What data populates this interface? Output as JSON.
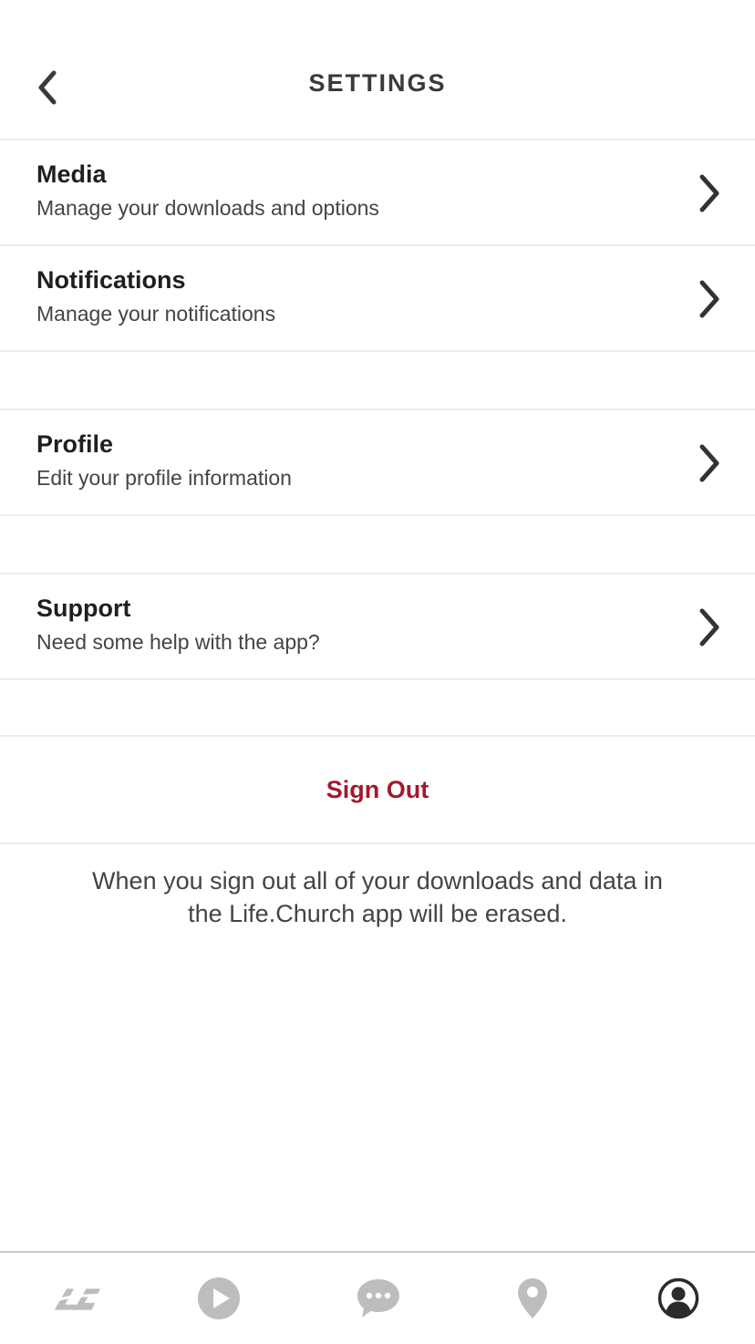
{
  "header": {
    "title": "SETTINGS"
  },
  "sections": [
    {
      "id": "media",
      "title": "Media",
      "subtitle": "Manage your downloads and options"
    },
    {
      "id": "notifications",
      "title": "Notifications",
      "subtitle": "Manage your notifications"
    },
    {
      "id": "profile",
      "title": "Profile",
      "subtitle": "Edit your profile information"
    },
    {
      "id": "support",
      "title": "Support",
      "subtitle": "Need some help with the app?"
    }
  ],
  "sign_out": {
    "label": "Sign Out",
    "color": "#a3192c",
    "warning": "When you sign out all of your downloads and data in the Life.Church app will be erased."
  },
  "tabbar": {
    "tabs": [
      {
        "icon": "lifechurch-logo-icon",
        "active": false
      },
      {
        "icon": "play-icon",
        "active": false
      },
      {
        "icon": "chat-icon",
        "active": false
      },
      {
        "icon": "location-pin-icon",
        "active": false
      },
      {
        "icon": "profile-icon",
        "active": true
      }
    ],
    "inactive_color": "#bdbdbd",
    "active_color": "#2b2b2b"
  }
}
